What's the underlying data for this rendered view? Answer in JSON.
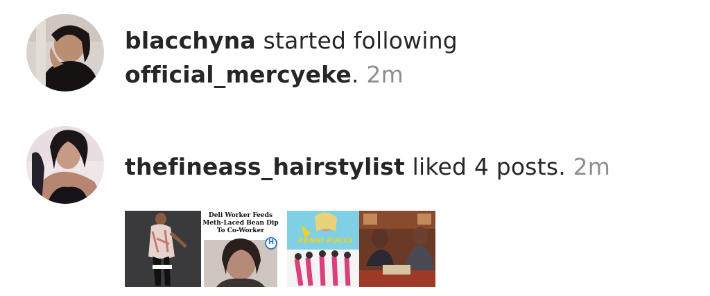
{
  "notifications": [
    {
      "username": "blacchyna",
      "action_line1": " started following",
      "target_user": "official_mercyeke",
      "punct": ".",
      "time": " 2m",
      "avatar_icon": "user-avatar-photo"
    },
    {
      "username": "thefineass_hairstylist",
      "action": " liked 4 posts.",
      "time": " 2m",
      "avatar_icon": "user-avatar-photo",
      "posts": [
        {
          "label": "post-thumbnail-1"
        },
        {
          "label": "post-thumbnail-2",
          "caption": "Deli Worker Feeds Meth-Laced Bean Dip To Co-Worker",
          "badge": "H"
        },
        {
          "label": "post-thumbnail-3",
          "overlay_text": "RENNI RUCCI"
        },
        {
          "label": "post-thumbnail-4"
        }
      ]
    }
  ],
  "colors": {
    "text": "#262626",
    "timestamp": "#8e8e8e",
    "background": "#ffffff"
  }
}
